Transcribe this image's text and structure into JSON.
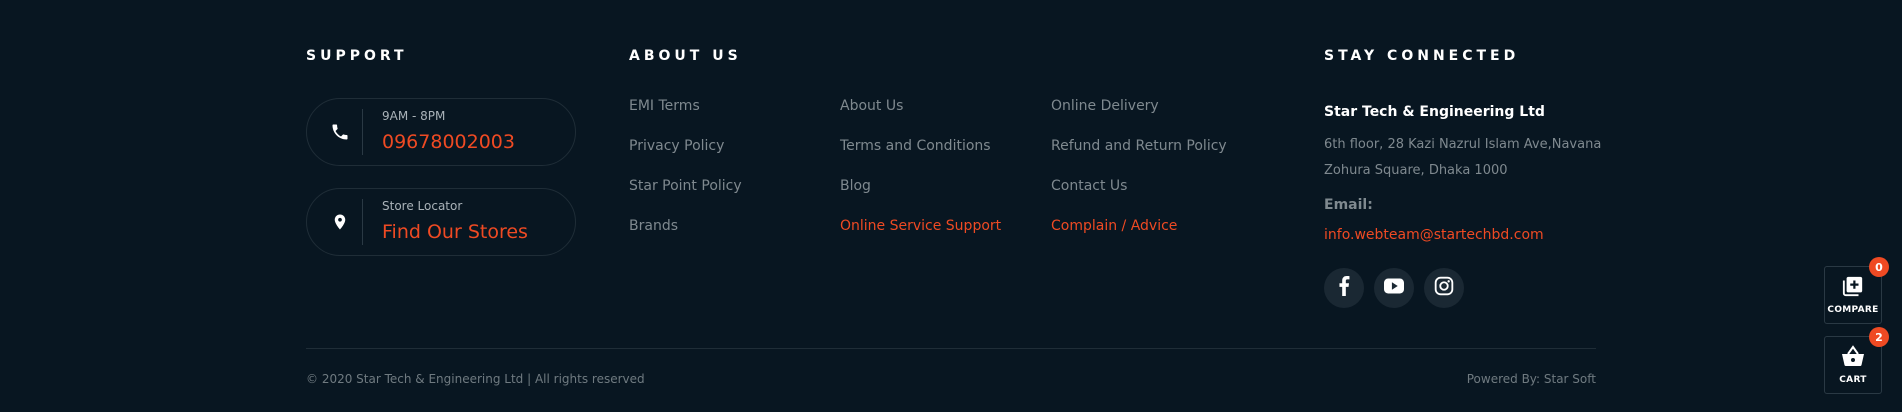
{
  "support": {
    "heading": "SUPPORT",
    "phone_card": {
      "small": "9AM - 8PM",
      "big": "09678002003"
    },
    "store_card": {
      "small": "Store Locator",
      "big": "Find Our Stores"
    }
  },
  "about": {
    "heading": "ABOUT US",
    "columns": [
      [
        "EMI Terms",
        "Privacy Policy",
        "Star Point Policy",
        "Brands"
      ],
      [
        "About Us",
        "Terms and Conditions",
        "Blog",
        "Online Service Support"
      ],
      [
        "Online Delivery",
        "Refund and Return Policy",
        "Contact Us",
        "Complain / Advice"
      ]
    ]
  },
  "connected": {
    "heading": "STAY CONNECTED",
    "company": "Star Tech & Engineering Ltd",
    "address": "6th floor, 28 Kazi Nazrul Islam Ave,Navana Zohura Square, Dhaka 1000",
    "email_label": "Email:",
    "email": "info.webteam@startechbd.com",
    "social_icons": [
      "facebook-icon",
      "youtube-icon",
      "instagram-icon"
    ]
  },
  "bottom": {
    "copyright": "© 2020 Star Tech & Engineering Ltd | All rights reserved",
    "powered": "Powered By: Star Soft"
  },
  "floating": {
    "compare": {
      "label": "COMPARE",
      "count": "0"
    },
    "cart": {
      "label": "CART",
      "count": "2"
    }
  },
  "colors": {
    "background": "#081621",
    "accent": "#ef4a23",
    "muted": "#7f898f"
  }
}
